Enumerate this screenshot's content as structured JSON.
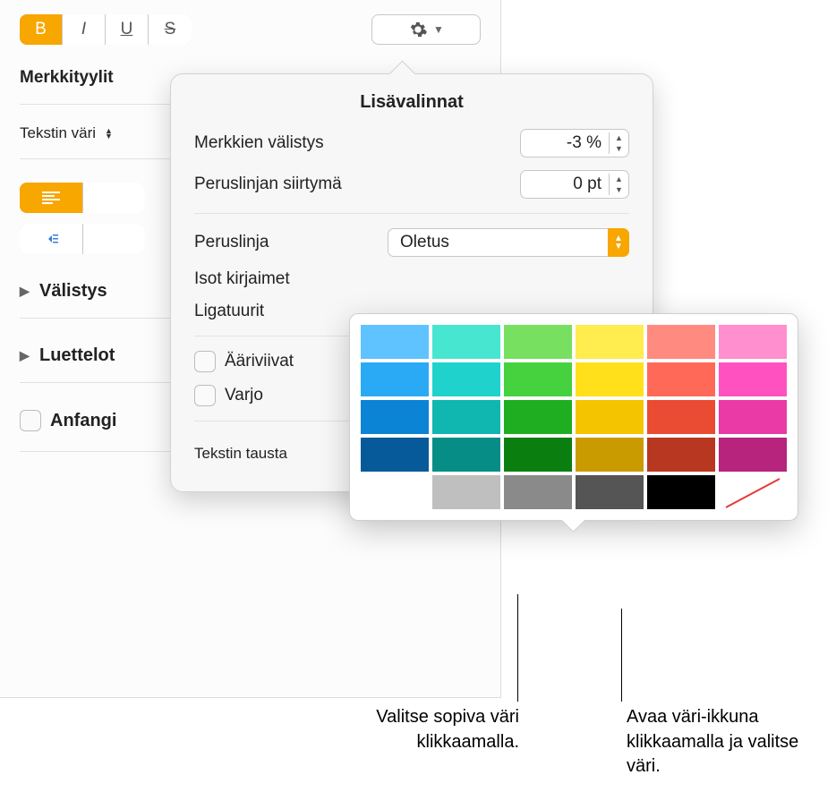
{
  "sidebar": {
    "style_label": "Merkkityylit",
    "text_color_label": "Tekstin väri",
    "disclosure_spacing": "Välistys",
    "disclosure_lists": "Luettelot",
    "dropcap_label": "Anfangi",
    "bold": "B",
    "italic": "I",
    "underline": "U",
    "strike": "S"
  },
  "popover": {
    "title": "Lisävalinnat",
    "char_spacing_label": "Merkkien välistys",
    "char_spacing_value": "-3 %",
    "baseline_shift_label": "Peruslinjan siirtymä",
    "baseline_shift_value": "0 pt",
    "baseline_label": "Peruslinja",
    "baseline_value": "Oletus",
    "caps_label": "Isot kirjaimet",
    "ligatures_label": "Ligatuurit",
    "outline_label": "Ääriviivat",
    "shadow_label": "Varjo",
    "text_bg_label": "Tekstin tausta"
  },
  "swatches": [
    [
      "#5ec3ff",
      "#47e6d1",
      "#78e060",
      "#ffec4f",
      "#ff8b80",
      "#ff8fcf"
    ],
    [
      "#2aa9f5",
      "#1fd2cc",
      "#46d13f",
      "#ffe01a",
      "#ff6a58",
      "#ff52c0"
    ],
    [
      "#0c84d6",
      "#0fb7b0",
      "#1fae22",
      "#f5c400",
      "#e94b33",
      "#e93aa6"
    ],
    [
      "#075a9a",
      "#068d86",
      "#0a7f10",
      "#c99b00",
      "#b83720",
      "#b6247d"
    ],
    [
      "#ffffff",
      "#bfbfbf",
      "#8a8a8a",
      "#555555",
      "#000000",
      "slash"
    ]
  ],
  "callouts": {
    "left": "Valitse sopiva väri klikkaamalla.",
    "right": "Avaa väri-ikkuna klikkaamalla ja valitse väri."
  }
}
